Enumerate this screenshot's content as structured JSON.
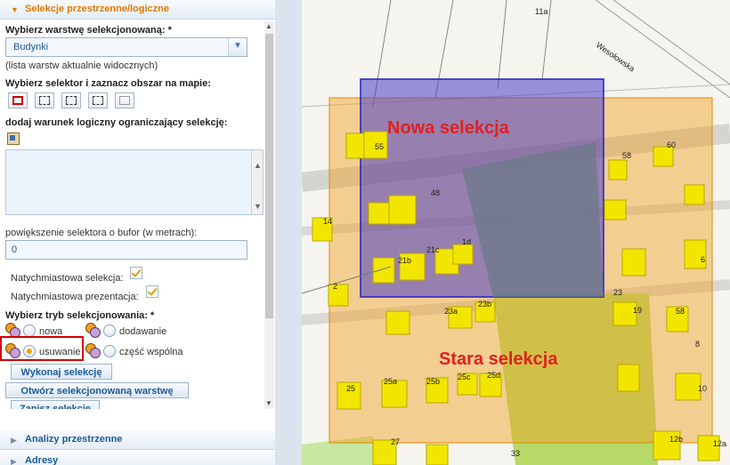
{
  "panel": {
    "section_title": "Selekcje przestrzenne/logiczne",
    "layer_label": "Wybierz warstwę selekcjonowaną: *",
    "layer_value": "Budynki",
    "layer_note": "(lista warstw aktualnie widocznych)",
    "selector_label": "Wybierz selektor i zaznacz obszar na mapie:",
    "selectors": [
      {
        "icon": "rectangle-select-icon"
      },
      {
        "icon": "polygon-select-icon"
      },
      {
        "icon": "circle-select-icon"
      },
      {
        "icon": "point-select-icon"
      },
      {
        "icon": "clear-select-icon"
      }
    ],
    "logic_label": "dodaj warunek logiczny ograniczający selekcję:",
    "buffer_label": "powiększenie selektora o bufor (w metrach):",
    "buffer_value": "0",
    "instant_selection_label": "Natychmiastowa selekcja:",
    "instant_presentation_label": "Natychmiastowa prezentacja:",
    "mode_label": "Wybierz tryb selekcjonowania: *",
    "modes": {
      "new": "nowa",
      "add": "dodawanie",
      "remove": "usuwanie",
      "intersect": "część wspólna"
    },
    "selected_mode": "usuwanie",
    "buttons": {
      "execute": "Wykonaj selekcję",
      "open_layer": "Otwórz selekcjonowaną warstwę",
      "save": "Zapisz selekcję"
    }
  },
  "accordion": {
    "spatial_analysis": "Analizy przestrzenne",
    "addresses": "Adresy"
  },
  "map": {
    "new_selection_label": "Nowa selekcja",
    "old_selection_label": "Stara selekcja",
    "street_name": "Wesołowska",
    "labels": [
      "11a",
      "58",
      "55",
      "60",
      "48",
      "1d",
      "21b",
      "21c",
      "23a",
      "23b",
      "58",
      "25",
      "25a",
      "25b",
      "25c",
      "25d",
      "27",
      "33",
      "12b",
      "12a",
      "6",
      "8",
      "10",
      "14",
      "2",
      "23",
      "19"
    ]
  },
  "colors": {
    "accent": "#e07b00",
    "link_blue": "#1b5a98",
    "new_selection_fill": "#5a4ccc",
    "old_selection_fill": "#f0a020",
    "highlight_red": "#d00000"
  }
}
